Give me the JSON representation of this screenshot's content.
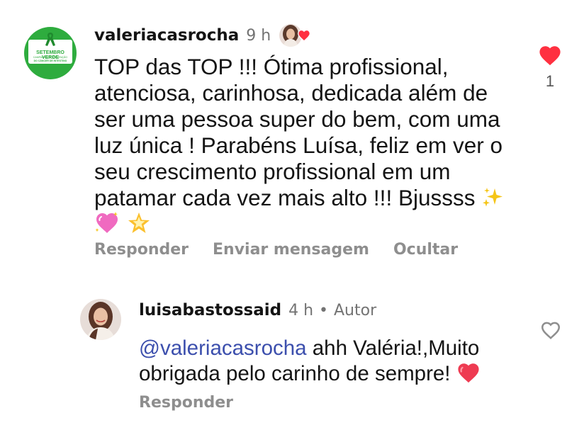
{
  "comment": {
    "username": "valeriacasrocha",
    "time": "9 h",
    "avatar_org": {
      "title": "SETEMBRO VERDE",
      "line1": "CAMPANHA DE PREVENÇÃO",
      "line2": "DO CÂNCER DE INTESTINO"
    },
    "liked_by_author": true,
    "text": "TOP das TOP !!! Ótima profissional, atenciosa, carinhosa, dedicada além de ser uma pessoa super do bem, com uma luz única ! Parabéns Luísa, feliz em ver o seu crescimento profissional em um patamar cada vez mais alto !!! Bjussss",
    "emojis": [
      "sparkles",
      "sparkling-heart",
      "glowing-star"
    ],
    "liked": true,
    "like_count": "1",
    "actions": {
      "reply": "Responder",
      "send_message": "Enviar mensagem",
      "hide": "Ocultar"
    }
  },
  "reply": {
    "username": "luisabastossaid",
    "time": "4 h",
    "author_badge": "Autor",
    "mention": "@valeriacasrocha",
    "text": " ahh Valéria!,Muito obrigada pelo carinho de sempre! ",
    "emoji": "red-heart",
    "liked": false,
    "actions": {
      "reply": "Responder"
    }
  },
  "colors": {
    "like_red": "#ff3040",
    "muted_text": "#737373",
    "action_gray": "#8e8e8e",
    "mention_blue": "#3c4fad",
    "avatar_green": "#2eac3e"
  }
}
